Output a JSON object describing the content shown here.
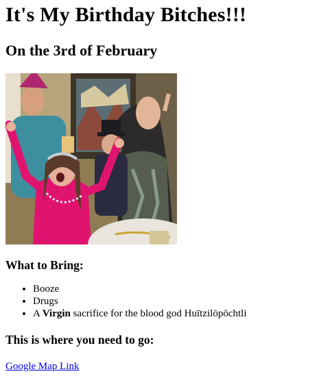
{
  "header": {
    "title": "It's My Birthday Bitches!!!",
    "subtitle": "On the 3rd of February"
  },
  "photo": {
    "icon": "party-photo"
  },
  "bring": {
    "heading": "What to Bring:",
    "items": [
      {
        "text": "Booze"
      },
      {
        "text": "Drugs"
      },
      {
        "prefix": "A ",
        "bold": "Virgin",
        "suffix": " sacrifice for the blood god Huītzilōpōchtli"
      }
    ]
  },
  "location": {
    "heading": "This is where you need to go:",
    "link_text": "Google Map Link"
  },
  "colors": {
    "link": "#0000ee",
    "text": "#000000",
    "background": "#ffffff"
  }
}
